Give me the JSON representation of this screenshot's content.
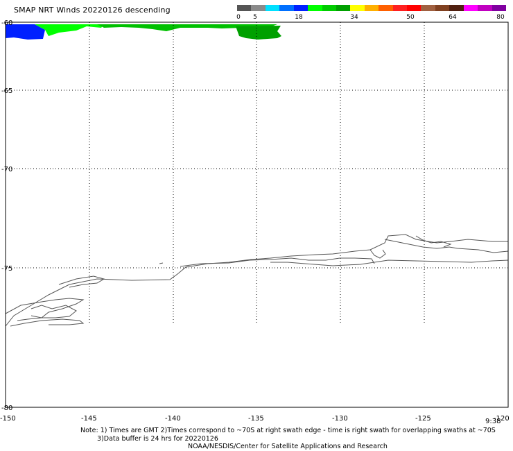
{
  "title": "SMAP NRT Winds  20220126 descending",
  "colorbar": {
    "segments": [
      "#555555",
      "#8a8a8a",
      "#00e0ff",
      "#0070ff",
      "#0020ff",
      "#00ff00",
      "#00cc00",
      "#00a000",
      "#ffff00",
      "#ffb000",
      "#ff6000",
      "#ff2020",
      "#ff0000",
      "#a06040",
      "#804020",
      "#502010",
      "#ff00ff",
      "#c000c0",
      "#8000a0"
    ],
    "labels": [
      "0",
      "5",
      "18",
      "34",
      "50",
      "64",
      "80"
    ]
  },
  "axes": {
    "lon_labels": [
      "-150",
      "-145",
      "-140",
      "-135",
      "-130",
      "-125",
      "-120"
    ],
    "lat_labels": [
      "-60",
      "-65",
      "-70",
      "-75",
      "-80"
    ]
  },
  "time_stamp": "9:38",
  "notes": {
    "line1": "Note: 1) Times are GMT 2)Times correspond to ~70S at right swath edge - time is right swath for overlapping swaths at ~70S",
    "line2": "3)Data buffer is 24 hrs for 20220126",
    "line3": "NOAA/NESDIS/Center for Satellite Applications and Research"
  },
  "colors": {
    "swath_blue": "#0020ff",
    "swath_light_green": "#00ff00",
    "swath_green": "#00c000",
    "swath_dark_green": "#00a000",
    "coast": "#555555"
  }
}
